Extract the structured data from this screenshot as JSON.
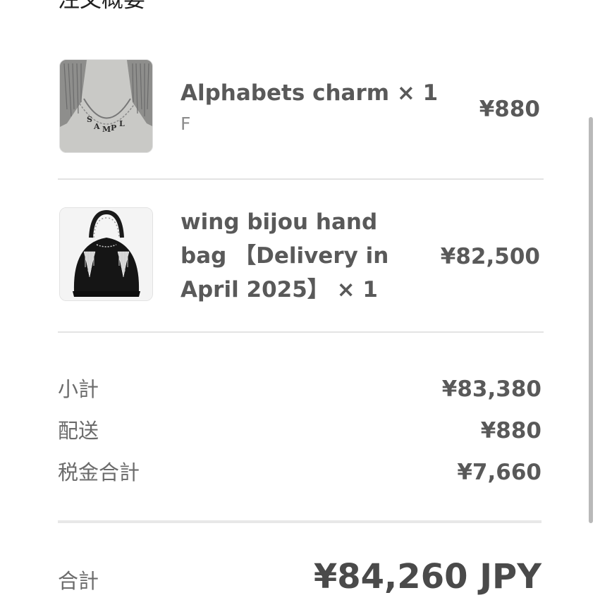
{
  "summary_title": "注文概要",
  "items": [
    {
      "name": "Alphabets charm × 1",
      "variant": "F",
      "price": "¥880",
      "image": "necklace-charm-image"
    },
    {
      "name": "wing bijou hand bag 【Delivery in April 2025】 × 1",
      "variant": "",
      "price": "¥82,500",
      "image": "black-handbag-image"
    }
  ],
  "summary": {
    "subtotal_label": "小計",
    "subtotal_value": "¥83,380",
    "shipping_label": "配送",
    "shipping_value": "¥880",
    "tax_label": "税金合計",
    "tax_value": "¥7,660"
  },
  "total": {
    "label": "合計",
    "value": "¥84,260 JPY"
  },
  "colors": {
    "text_primary": "#595959",
    "text_secondary": "#8c8c8c",
    "divider": "#e3e3e3",
    "scrollbar": "#b9b9b9"
  }
}
